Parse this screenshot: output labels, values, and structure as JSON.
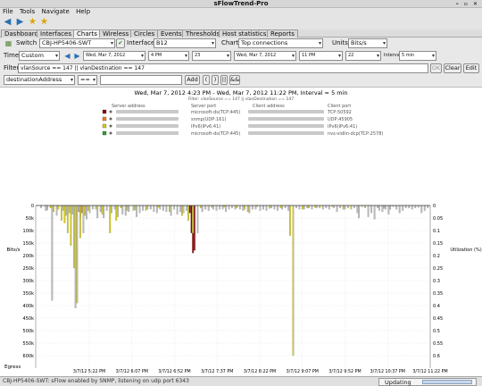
{
  "window": {
    "title": "sFlowTrend-Pro"
  },
  "menu": [
    "File",
    "Tools",
    "Navigate",
    "Help"
  ],
  "tabs": [
    "Dashboard",
    "Interfaces",
    "Charts",
    "Wireless",
    "Circles",
    "Events",
    "Thresholds",
    "Host statistics",
    "Reports"
  ],
  "active_tab": "Charts",
  "controls": {
    "switch_label": "Switch",
    "switch_value": "CBJ-HP5406-SWT",
    "interface_label": "Interface",
    "interface_value": "B12",
    "chart_label": "Chart",
    "chart_value": "Top connections",
    "units_label": "Units",
    "units_value": "Bits/s",
    "time_label": "Time",
    "time_value": "Custom",
    "start_date": "Wed, Mar 7, 2012",
    "start_hour": "4 PM",
    "start_min": "23",
    "end_date": "Wed, Mar 7, 2012",
    "end_hour": "11 PM",
    "end_min": "22",
    "interval_label": "Interval",
    "interval_value": "5 min",
    "filter_label": "Filter",
    "filter_value": "vlanSource == 147 || vlanDestination == 147",
    "ok_label": "OK",
    "clear_label": "Clear",
    "edit_label": "Edit",
    "field_value": "destinationAddress",
    "op_value": "==",
    "add_label": "Add",
    "paren_open": "(",
    "paren_close": ")",
    "or_label": "||",
    "and_label": "&&"
  },
  "chart": {
    "title": "Wed, Mar 7, 2012 4:23 PM - Wed, Mar 7, 2012 11:22 PM, Interval = 5 min",
    "subtitle": "Filter: vlanSource == 147 || vlanDestination == 147",
    "legend_headers": [
      "Server address",
      "Server port",
      "Client address",
      "Client port"
    ],
    "legend_rows": [
      {
        "color": "#8b0000",
        "server_port": "microsoft-ds(TCP:445)",
        "client_port": "TCP:50592"
      },
      {
        "color": "#f07e20",
        "server_port": "snmp(UDP:161)",
        "client_port": "UDP:45905"
      },
      {
        "color": "#d4cc18",
        "server_port": "IPv6(IPv6:41)",
        "client_port": "IPv6(IPv6:41)"
      },
      {
        "color": "#2e9e2e",
        "server_port": "microsoft-ds(TCP:445)",
        "client_port": "nvs-vidlin-dcp(TCP:2578)"
      }
    ],
    "left_axis_label": "Bits/s",
    "right_axis_label": "Utilization (%)",
    "bottom_label": "Egress",
    "left_ticks": [
      "50k",
      "100k",
      "150k",
      "200k",
      "250k",
      "300k",
      "350k",
      "400k",
      "450k",
      "500k",
      "550k",
      "600k"
    ],
    "right_ticks": [
      "0.05",
      "0.1",
      "0.15",
      "0.2",
      "0.25",
      "0.3",
      "0.35",
      "0.4",
      "0.45",
      "0.5",
      "0.55",
      "0.6"
    ],
    "x_ticks": [
      "3/7/12 5:22 PM",
      "3/7/12 6:07 PM",
      "3/7/12 6:52 PM",
      "3/7/12 7:37 PM",
      "3/7/12 8:22 PM",
      "3/7/12 9:07 PM",
      "3/7/12 9:52 PM",
      "3/7/12 10:37 PM",
      "3/7/12 11:22 PM"
    ],
    "left_zero": "0",
    "right_zero": "0"
  },
  "chart_data": {
    "type": "bar",
    "ylabel": "Bits/s",
    "ylim": [
      0,
      650000
    ],
    "y2label": "Utilization (%)",
    "y2lim": [
      0,
      0.65
    ],
    "grid": true,
    "orientation": "downward (egress)",
    "x_range": [
      "3/7/12 4:23 PM",
      "3/7/12 11:22 PM"
    ],
    "interval": "5 min",
    "series": [
      {
        "name": "microsoft-ds(TCP:445) / TCP:50592",
        "color": "#8b0000",
        "points": [
          [
            98,
            30000
          ],
          [
            99,
            110000
          ],
          [
            100,
            190000
          ],
          [
            101,
            180000
          ]
        ]
      },
      {
        "name": "snmp(UDP:161) / UDP:45905",
        "color": "#f07e20",
        "points": [
          [
            27,
            25000
          ],
          [
            28,
            50000
          ],
          [
            29,
            30000
          ]
        ]
      },
      {
        "name": "IPv6(IPv6:41) / IPv6(IPv6:41)",
        "color": "#d4cc18",
        "points": [
          [
            9,
            10000
          ],
          [
            11,
            25000
          ],
          [
            14,
            15000
          ],
          [
            16,
            60000
          ],
          [
            18,
            70000
          ],
          [
            20,
            110000
          ],
          [
            22,
            160000
          ],
          [
            24,
            250000
          ],
          [
            26,
            390000
          ],
          [
            28,
            130000
          ],
          [
            31,
            40000
          ],
          [
            33,
            20000
          ],
          [
            38,
            15000
          ],
          [
            42,
            35000
          ],
          [
            47,
            110000
          ],
          [
            51,
            60000
          ],
          [
            54,
            10000
          ],
          [
            58,
            20000
          ],
          [
            63,
            18000
          ],
          [
            70,
            20000
          ],
          [
            78,
            8000
          ],
          [
            85,
            25000
          ],
          [
            93,
            40000
          ],
          [
            97,
            60000
          ],
          [
            100,
            110000
          ],
          [
            105,
            10000
          ],
          [
            112,
            8000
          ],
          [
            120,
            6000
          ],
          [
            128,
            10000
          ],
          [
            133,
            15000
          ],
          [
            136,
            30000
          ],
          [
            141,
            5000
          ],
          [
            149,
            12000
          ],
          [
            156,
            10000
          ],
          [
            162,
            120000
          ],
          [
            164,
            600000
          ],
          [
            170,
            15000
          ],
          [
            174,
            10000
          ],
          [
            178,
            8000
          ],
          [
            181,
            10000
          ],
          [
            189,
            5000
          ],
          [
            196,
            15000
          ],
          [
            201,
            15000
          ],
          [
            208,
            5000
          ]
        ]
      },
      {
        "name": "microsoft-ds(TCP:445) / nvs-vidlin-dcp(TCP:2578)",
        "color": "#bbbbbb",
        "points": [
          [
            3,
            10000
          ],
          [
            6,
            20000
          ],
          [
            7,
            18000
          ],
          [
            10,
            380000
          ],
          [
            13,
            40000
          ],
          [
            17,
            20000
          ],
          [
            19,
            40000
          ],
          [
            21,
            30000
          ],
          [
            23,
            35000
          ],
          [
            25,
            410000
          ],
          [
            27,
            20000
          ],
          [
            30,
            110000
          ],
          [
            32,
            55000
          ],
          [
            34,
            30000
          ],
          [
            36,
            15000
          ],
          [
            39,
            50000
          ],
          [
            41,
            25000
          ],
          [
            43,
            50000
          ],
          [
            45,
            20000
          ],
          [
            48,
            30000
          ],
          [
            50,
            15000
          ],
          [
            52,
            45000
          ],
          [
            55,
            35000
          ],
          [
            57,
            40000
          ],
          [
            59,
            25000
          ],
          [
            62,
            20000
          ],
          [
            64,
            45000
          ],
          [
            66,
            30000
          ],
          [
            68,
            20000
          ],
          [
            71,
            15000
          ],
          [
            73,
            15000
          ],
          [
            75,
            25000
          ],
          [
            77,
            30000
          ],
          [
            79,
            15000
          ],
          [
            81,
            20000
          ],
          [
            83,
            25000
          ],
          [
            86,
            40000
          ],
          [
            88,
            15000
          ],
          [
            90,
            35000
          ],
          [
            92,
            25000
          ],
          [
            94,
            30000
          ],
          [
            96,
            20000
          ],
          [
            103,
            110000
          ],
          [
            106,
            25000
          ],
          [
            108,
            15000
          ],
          [
            110,
            20000
          ],
          [
            113,
            15000
          ],
          [
            115,
            20000
          ],
          [
            117,
            15000
          ],
          [
            119,
            15000
          ],
          [
            121,
            25000
          ],
          [
            123,
            15000
          ],
          [
            125,
            10000
          ],
          [
            127,
            15000
          ],
          [
            130,
            15000
          ],
          [
            132,
            20000
          ],
          [
            135,
            25000
          ],
          [
            138,
            15000
          ],
          [
            140,
            15000
          ],
          [
            143,
            20000
          ],
          [
            145,
            15000
          ],
          [
            147,
            20000
          ],
          [
            150,
            10000
          ],
          [
            152,
            15000
          ],
          [
            154,
            20000
          ],
          [
            157,
            15000
          ],
          [
            159,
            10000
          ],
          [
            161,
            20000
          ],
          [
            166,
            10000
          ],
          [
            168,
            15000
          ],
          [
            171,
            15000
          ],
          [
            173,
            10000
          ],
          [
            176,
            15000
          ],
          [
            179,
            10000
          ],
          [
            183,
            15000
          ],
          [
            185,
            10000
          ],
          [
            187,
            15000
          ],
          [
            190,
            10000
          ],
          [
            192,
            25000
          ],
          [
            194,
            10000
          ],
          [
            197,
            15000
          ],
          [
            199,
            10000
          ],
          [
            203,
            10000
          ],
          [
            205,
            30000
          ],
          [
            206,
            50000
          ],
          [
            210,
            10000
          ],
          [
            212,
            45000
          ],
          [
            214,
            30000
          ],
          [
            216,
            55000
          ],
          [
            218,
            10000
          ],
          [
            219,
            20000
          ],
          [
            221,
            25000
          ],
          [
            222,
            12000
          ],
          [
            223,
            15000
          ],
          [
            225,
            35000
          ],
          [
            226,
            15000
          ],
          [
            228,
            5000
          ],
          [
            230,
            15000
          ],
          [
            232,
            30000
          ],
          [
            234,
            20000
          ],
          [
            236,
            10000
          ],
          [
            238,
            10000
          ],
          [
            240,
            15000
          ],
          [
            242,
            10000
          ],
          [
            244,
            8000
          ],
          [
            246,
            30000
          ],
          [
            248,
            20000
          ],
          [
            250,
            10000
          ]
        ]
      }
    ]
  },
  "status": {
    "message": "CBJ-HP5406-SWT: sFlow enabled by SNMP, listening on udp port 6343",
    "progress_label": "Updating"
  }
}
